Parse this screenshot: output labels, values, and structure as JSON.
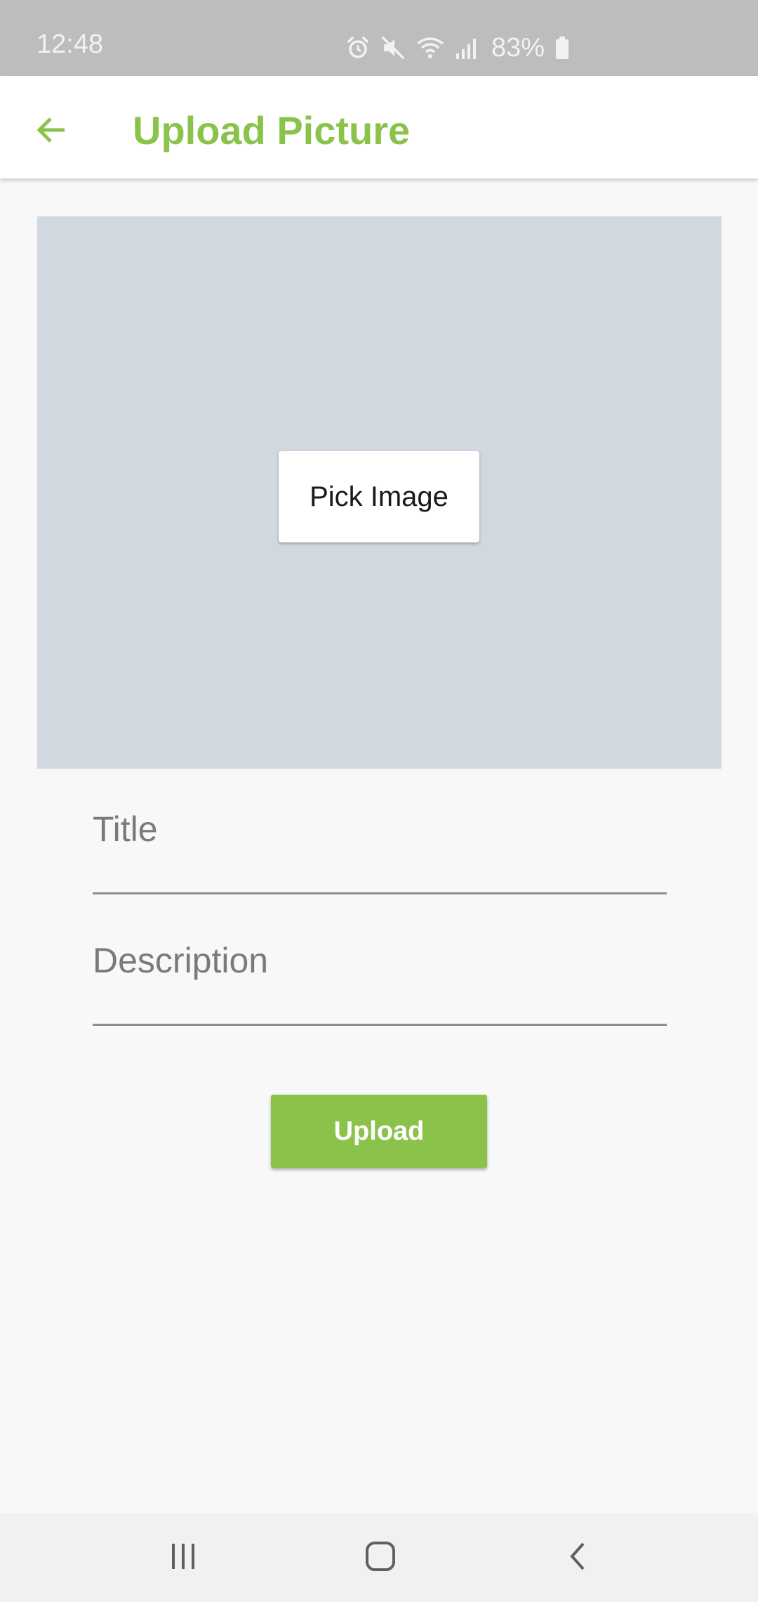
{
  "status_bar": {
    "time": "12:48",
    "battery": "83%",
    "icons": [
      "alarm-icon",
      "mute-icon",
      "wifi-icon",
      "signal-icon",
      "battery-icon"
    ]
  },
  "app_bar": {
    "title": "Upload Picture",
    "back_icon": "arrow-left-icon"
  },
  "image_picker": {
    "button_label": "Pick Image"
  },
  "form": {
    "title_placeholder": "Title",
    "description_placeholder": "Description",
    "upload_label": "Upload"
  },
  "nav_bar": {
    "icons": [
      "recents-icon",
      "home-icon",
      "back-icon"
    ]
  },
  "colors": {
    "accent": "#8bc34a",
    "status_bar": "#bdbdbd",
    "image_placeholder": "#d1d8e0",
    "background": "#f8f8f8"
  }
}
